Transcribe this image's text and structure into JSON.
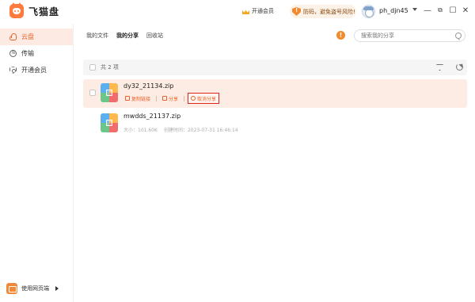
{
  "app": {
    "name": "飞猫盘"
  },
  "header": {
    "vip_label": "开通会员",
    "warning_text": "防码，避免盗号风险!",
    "username": "ph_djn45",
    "window_buttons": [
      "minimize-icon",
      "restore-icon",
      "maximize-icon",
      "close-icon"
    ]
  },
  "sidebar": {
    "items": [
      {
        "label": "云盘",
        "icon": "cloud-icon",
        "active": true
      },
      {
        "label": "传输",
        "icon": "transfer-icon",
        "active": false
      },
      {
        "label": "开通会员",
        "icon": "vip-shield-icon",
        "active": false
      }
    ],
    "web_link_label": "使用网页端"
  },
  "tabs": [
    {
      "label": "我的文件",
      "active": false
    },
    {
      "label": "我的分享",
      "active": true
    },
    {
      "label": "回收站",
      "active": false
    }
  ],
  "search": {
    "placeholder": "搜索我的分享"
  },
  "list": {
    "count_label": "共 2 项",
    "rows": [
      {
        "name": "dy32_21134.zip",
        "selected": true,
        "actions": [
          "复制链接",
          "分享",
          "取消分享"
        ]
      },
      {
        "name": "mwdds_21137.zip",
        "selected": false,
        "size": "大小：101.60K",
        "created": "创建时间：2023-07-31 16:46:14"
      }
    ]
  },
  "colors": {
    "accent": "#e8632b",
    "selected_row_bg": "#fdece3",
    "highlight_border": "#e0231b",
    "info": "#f08a2b"
  }
}
